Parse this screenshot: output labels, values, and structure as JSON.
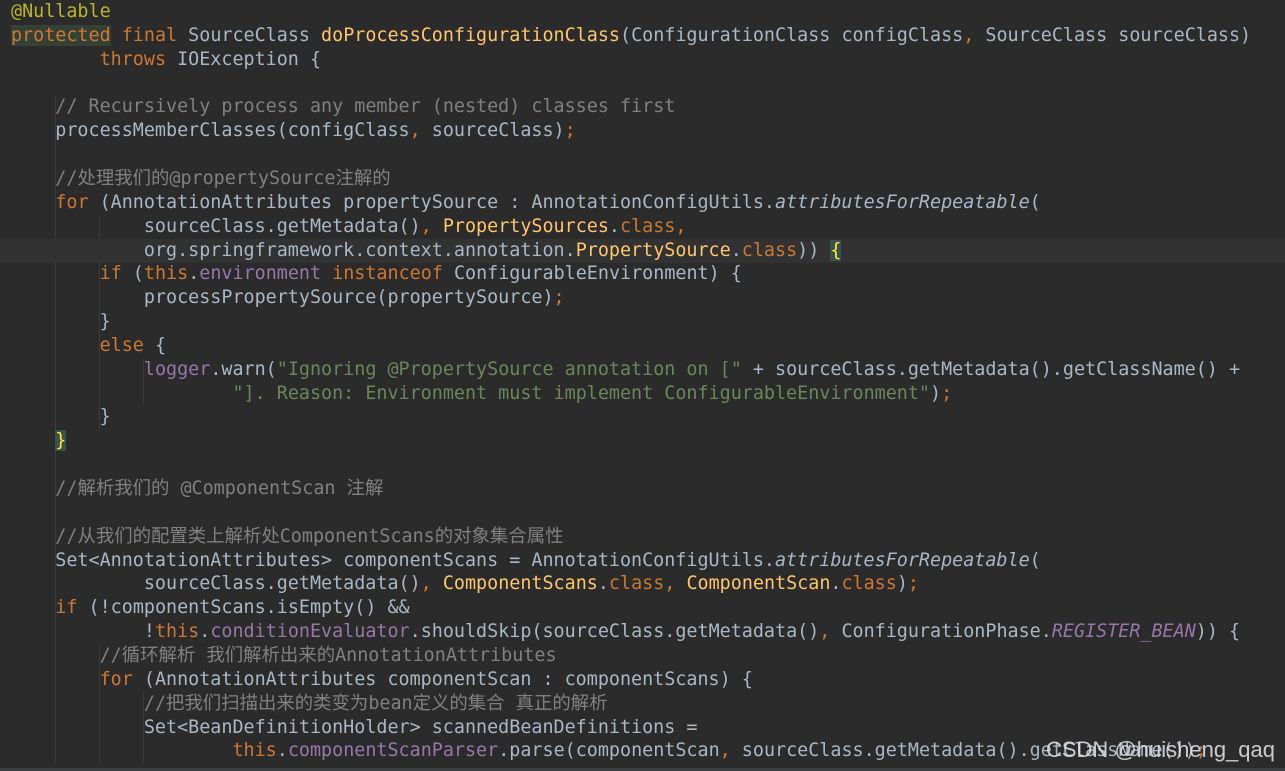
{
  "editor": {
    "theme": "Darcula",
    "colors": {
      "background": "#2b2b2b",
      "keyword": "#cc7832",
      "annotation": "#bbb529",
      "method_decl": "#ffc66d",
      "comment": "#808080",
      "string": "#6a8759",
      "field": "#9876aa",
      "default": "#a9b7c6"
    },
    "lines": [
      [
        {
          "t": "@Nullable",
          "c": "ann"
        }
      ],
      [
        {
          "t": "protected",
          "c": "kw kwbg"
        },
        {
          "t": " "
        },
        {
          "t": "final",
          "c": "kw"
        },
        {
          "t": " SourceClass "
        },
        {
          "t": "doProcessConfigurationClass",
          "c": "fn"
        },
        {
          "t": "(ConfigurationClass configClass"
        },
        {
          "t": ",",
          "c": "kw"
        },
        {
          "t": " SourceClass sourceClass)"
        }
      ],
      [
        {
          "t": "        "
        },
        {
          "t": "throws",
          "c": "kw"
        },
        {
          "t": " IOException {"
        }
      ],
      [],
      [
        {
          "t": "    "
        },
        {
          "t": "// Recursively process any member (nested) classes first",
          "c": "cm"
        }
      ],
      [
        {
          "t": "    processMemberClasses(configClass"
        },
        {
          "t": ",",
          "c": "kw"
        },
        {
          "t": " sourceClass)"
        },
        {
          "t": ";",
          "c": "kw"
        }
      ],
      [],
      [
        {
          "t": "    "
        },
        {
          "t": "//处理我们的@propertySource注解的",
          "c": "cm"
        }
      ],
      [
        {
          "t": "    "
        },
        {
          "t": "for",
          "c": "kw"
        },
        {
          "t": " (AnnotationAttributes propertySource : AnnotationConfigUtils."
        },
        {
          "t": "attributesForRepeatable",
          "c": "ital"
        },
        {
          "t": "("
        }
      ],
      [
        {
          "t": "            sourceClass.getMetadata()"
        },
        {
          "t": ",",
          "c": "kw"
        },
        {
          "t": " "
        },
        {
          "t": "PropertySources",
          "c": "cls"
        },
        {
          "t": ".",
          "c": ""
        },
        {
          "t": "class",
          "c": "kw"
        },
        {
          "t": ",",
          "c": "kw"
        }
      ],
      [
        {
          "t": "            org.springframework.context.annotation."
        },
        {
          "t": "PropertySource",
          "c": "cls"
        },
        {
          "t": "."
        },
        {
          "t": "class",
          "c": "kw"
        },
        {
          "t": ")) "
        },
        {
          "t": "{",
          "c": "brace-hl"
        }
      ],
      [
        {
          "t": "        "
        },
        {
          "t": "if",
          "c": "kw"
        },
        {
          "t": " ("
        },
        {
          "t": "this",
          "c": "kw"
        },
        {
          "t": "."
        },
        {
          "t": "environment",
          "c": "fld"
        },
        {
          "t": " "
        },
        {
          "t": "instanceof",
          "c": "kw"
        },
        {
          "t": " ConfigurableEnvironment) {"
        }
      ],
      [
        {
          "t": "            processPropertySource(propertySource)"
        },
        {
          "t": ";",
          "c": "kw"
        }
      ],
      [
        {
          "t": "        }"
        }
      ],
      [
        {
          "t": "        "
        },
        {
          "t": "else",
          "c": "kw"
        },
        {
          "t": " {"
        }
      ],
      [
        {
          "t": "            "
        },
        {
          "t": "logger",
          "c": "fld"
        },
        {
          "t": ".warn("
        },
        {
          "t": "\"Ignoring @PropertySource annotation on [\"",
          "c": "str"
        },
        {
          "t": " + sourceClass.getMetadata().getClassName() +"
        }
      ],
      [
        {
          "t": "                    "
        },
        {
          "t": "\"]. Reason: Environment must implement ConfigurableEnvironment\"",
          "c": "str"
        },
        {
          "t": ")"
        },
        {
          "t": ";",
          "c": "kw"
        }
      ],
      [
        {
          "t": "        }"
        }
      ],
      [
        {
          "t": "    "
        },
        {
          "t": "}",
          "c": "brace-hl"
        }
      ],
      [],
      [
        {
          "t": "    "
        },
        {
          "t": "//解析我们的 @ComponentScan 注解",
          "c": "cm"
        }
      ],
      [],
      [
        {
          "t": "    "
        },
        {
          "t": "//从我们的配置类上解析处ComponentScans的对象集合属性",
          "c": "cm"
        }
      ],
      [
        {
          "t": "    Set<AnnotationAttributes> componentScans = AnnotationConfigUtils."
        },
        {
          "t": "attributesForRepeatable",
          "c": "ital"
        },
        {
          "t": "("
        }
      ],
      [
        {
          "t": "            sourceClass.getMetadata()"
        },
        {
          "t": ",",
          "c": "kw"
        },
        {
          "t": " "
        },
        {
          "t": "ComponentScans",
          "c": "cls"
        },
        {
          "t": "."
        },
        {
          "t": "class",
          "c": "kw"
        },
        {
          "t": ",",
          "c": "kw"
        },
        {
          "t": " "
        },
        {
          "t": "ComponentScan",
          "c": "cls"
        },
        {
          "t": "."
        },
        {
          "t": "class",
          "c": "kw"
        },
        {
          "t": ")"
        },
        {
          "t": ";",
          "c": "kw"
        }
      ],
      [
        {
          "t": "    "
        },
        {
          "t": "if",
          "c": "kw"
        },
        {
          "t": " (!componentScans.isEmpty() &&"
        }
      ],
      [
        {
          "t": "            !"
        },
        {
          "t": "this",
          "c": "kw"
        },
        {
          "t": "."
        },
        {
          "t": "conditionEvaluator",
          "c": "fld"
        },
        {
          "t": ".shouldSkip(sourceClass.getMetadata()"
        },
        {
          "t": ",",
          "c": "kw"
        },
        {
          "t": " ConfigurationPhase."
        },
        {
          "t": "REGISTER_BEAN",
          "c": "stat"
        },
        {
          "t": ")) {"
        }
      ],
      [
        {
          "t": "        "
        },
        {
          "t": "//循环解析 我们解析出来的AnnotationAttributes",
          "c": "cm"
        }
      ],
      [
        {
          "t": "        "
        },
        {
          "t": "for",
          "c": "kw"
        },
        {
          "t": " (AnnotationAttributes componentScan : componentScans) {"
        }
      ],
      [
        {
          "t": "            "
        },
        {
          "t": "//把我们扫描出来的类变为bean定义的集合 真正的解析",
          "c": "cm"
        }
      ],
      [
        {
          "t": "            Set<BeanDefinitionHolder> scannedBeanDefinitions ="
        }
      ],
      [
        {
          "t": "                    "
        },
        {
          "t": "this",
          "c": "kw"
        },
        {
          "t": "."
        },
        {
          "t": "componentScanParser",
          "c": "fld"
        },
        {
          "t": ".parse(componentScan"
        },
        {
          "t": ",",
          "c": "kw"
        },
        {
          "t": " sourceClass.getMetadata().getClassName())"
        },
        {
          "t": ";",
          "c": "kw"
        }
      ]
    ],
    "caret_line": 10
  },
  "watermark": "CSDN @huisheng_qaq"
}
